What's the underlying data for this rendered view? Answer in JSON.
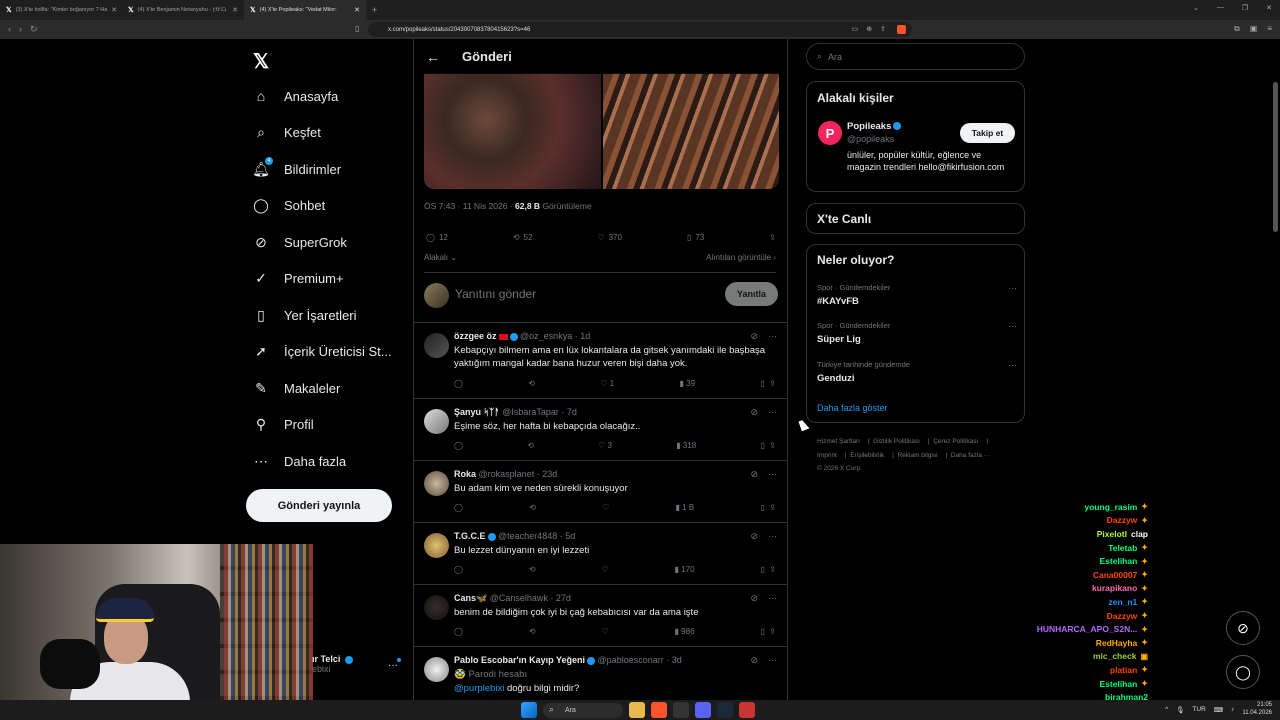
{
  "browser": {
    "tabs": [
      {
        "label": "(3) X'te kollfa: \"Kimler boğanıyor ? Ha"
      },
      {
        "label": "(4) X'te Benjamin Netanyahu - בנימין"
      },
      {
        "label": "(4) X'te Popileaks: \"Vedat Milor:"
      }
    ],
    "url": "x.com/popileaks/status/2043007083780415623?s=46"
  },
  "sidebar": {
    "items": [
      {
        "label": "Anasayfa"
      },
      {
        "label": "Keşfet"
      },
      {
        "label": "Bildirimler",
        "badge": "4"
      },
      {
        "label": "Sohbet"
      },
      {
        "label": "SuperGrok"
      },
      {
        "label": "Premium+"
      },
      {
        "label": "Yer İşaretleri"
      },
      {
        "label": "İçerik Üreticisi St..."
      },
      {
        "label": "Makaleler"
      },
      {
        "label": "Profil"
      },
      {
        "label": "Daha fazla"
      }
    ],
    "post_button": "Gönderi yayınla",
    "account": {
      "name": "ır Telci",
      "handle": "ebixi"
    }
  },
  "post": {
    "header_title": "Gönderi",
    "time": "ÖS 7:43 · 11 Nis 2026 · ",
    "views": "62,8 B",
    "views_label": " Görüntüleme",
    "stats": {
      "replies": "12",
      "reposts": "52",
      "likes": "370",
      "bookmarks": "73"
    },
    "filter_label": "Alakalı",
    "quotes_link": "Alıntıları görüntüle",
    "reply_placeholder": "Yanıtını gönder",
    "reply_button": "Yanıtla"
  },
  "replies": [
    {
      "name": "özzgee öz",
      "handle": "@oz_esnkya · 1d",
      "text": "Kebapçıyı bilmem ama en lüx lokantalara da gitsek yanımdaki ile başbaşa yaktığım mangal kadar bana huzur veren bişi daha yok.",
      "likes": "1",
      "views": "39"
    },
    {
      "name": "Şanyu ᛋᛉᚨ",
      "handle": "@IsbaraTapar · 7d",
      "text": "Eşime söz, her hafta bi kebapçıda olacağız..",
      "likes": "3",
      "views": "318"
    },
    {
      "name": "Roka",
      "handle": "@rokasplanet · 23d",
      "text": "Bu adam kim ve neden sürekli konuşuyor",
      "likes": "",
      "views": "1 B"
    },
    {
      "name": "T.G.C.E",
      "handle": "@teacher4848 · 5d",
      "text": "Bu lezzet dünyanın en iyi lezzeti",
      "likes": "",
      "views": "170"
    },
    {
      "name": "Cans🦋",
      "handle": "@Canselhawk · 27d",
      "text": "benim de bildiğim çok iyi bi çağ kebabıcısı var da ama işte",
      "likes": "",
      "views": "986"
    },
    {
      "name": "Pablo Escobar'ın Kayıp Yeğeni",
      "handle": "@pabloesconarr · 3d",
      "sub": "🥸 Parodi hesabı",
      "mention": "@purplebixi",
      "text": " doğru bilgi midir?"
    }
  ],
  "right": {
    "search_placeholder": "Ara",
    "related_title": "Alakalı kişiler",
    "person": {
      "logo": "P",
      "name": "Popileaks",
      "handle": "@popileaks",
      "bio": "ünlüler, popüler kültür, eğlence ve magazin trendleri hello@fikirfusion.com",
      "follow": "Takip et"
    },
    "live_title": "X'te Canlı",
    "trends_title": "Neler oluyor?",
    "trends": [
      {
        "category": "Spor · Gündemdekiler",
        "name": "#KAYvFB"
      },
      {
        "category": "Spor · Gündemdekiler",
        "name": "Süper Lig"
      },
      {
        "category": "Türkiye tarihinde gündemde",
        "name": "Genduzi"
      }
    ],
    "show_more": "Daha fazla göster",
    "footer": [
      "Hizmet Şartları",
      "Gizlilik Politikası",
      "Çerez Politikası",
      "Imprint",
      "Erişilebilirlik",
      "Reklam bilgisi",
      "Daha fazla ···",
      "© 2026 X Corp."
    ]
  },
  "chat": [
    {
      "user": "young_rasim",
      "color": "#00ff7f",
      "msg": ""
    },
    {
      "user": "Dazzyw",
      "color": "#ff4500",
      "msg": ""
    },
    {
      "user": "Pixelotl",
      "color": "#adff2f",
      "msg": "clap"
    },
    {
      "user": "Teletab",
      "color": "#00ff7f",
      "msg": ""
    },
    {
      "user": "Estelihan",
      "color": "#00ff7f",
      "msg": ""
    },
    {
      "user": "Cana00007",
      "color": "#ff4500",
      "msg": ""
    },
    {
      "user": "kurapikano",
      "color": "#ff69b4",
      "msg": ""
    },
    {
      "user": "zen_n1",
      "color": "#1e90ff",
      "msg": ""
    },
    {
      "user": "Dazzyw",
      "color": "#ff4500",
      "msg": ""
    },
    {
      "user": "HUNHARCA_APO_S2N...",
      "color": "#b768ff",
      "msg": ""
    },
    {
      "user": "RedHayha",
      "color": "#ffa500",
      "msg": ""
    },
    {
      "user": "mic_check",
      "color": "#9acd32",
      "msg": ""
    },
    {
      "user": "platian",
      "color": "#ff4500",
      "msg": ""
    },
    {
      "user": "Estelihan",
      "color": "#00ff7f",
      "msg": ""
    },
    {
      "user": "birahman2",
      "color": "#00ff7f",
      "msg": ""
    }
  ],
  "taskbar": {
    "search": "Ara",
    "lang": "TUR",
    "time": "21:05",
    "date": "11.04.2026"
  }
}
